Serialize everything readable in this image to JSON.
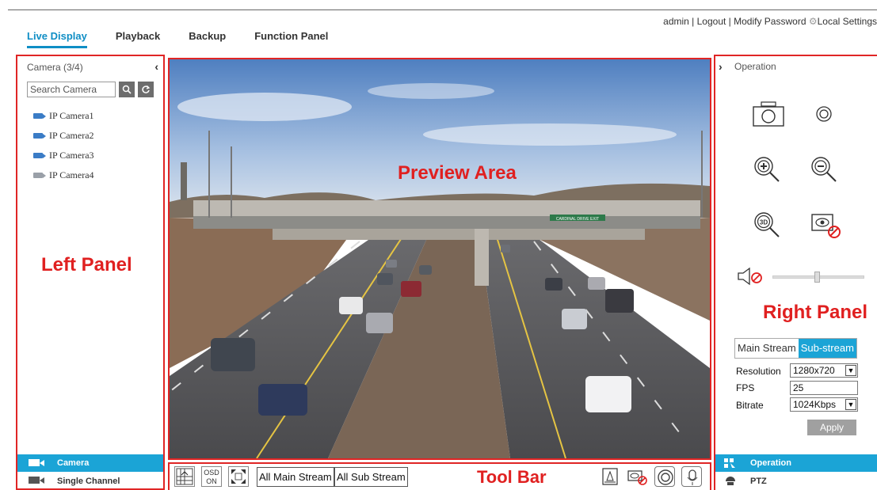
{
  "header": {
    "user": "admin |",
    "logout": "Logout |",
    "modify_password": "Modify Password",
    "local_settings": "Local Settings"
  },
  "nav": {
    "tabs": [
      {
        "label": "Live Display",
        "active": true
      },
      {
        "label": "Playback"
      },
      {
        "label": "Backup"
      },
      {
        "label": "Function Panel"
      }
    ]
  },
  "left_panel": {
    "header": "Camera (3/4)",
    "search_placeholder": "Search Camera",
    "cameras": [
      {
        "label": "IP Camera1",
        "online": true
      },
      {
        "label": "IP Camera2",
        "online": true
      },
      {
        "label": "IP Camera3",
        "online": true
      },
      {
        "label": "IP Camera4",
        "online": false
      }
    ],
    "annotation": "Left Panel",
    "bottom_tabs": [
      "Camera",
      "Single Channel Sequences"
    ]
  },
  "preview": {
    "annotation": "Preview Area",
    "sign_text": "CARDINAL DRIVE EXIT"
  },
  "toolbar": {
    "osd_line1": "OSD",
    "osd_line2": "ON",
    "all_main_stream": "All Main Stream",
    "all_sub_stream": "All Sub Stream",
    "annotation": "Tool Bar"
  },
  "right_panel": {
    "header": "Operation",
    "annotation": "Right Panel",
    "stream_tabs": [
      "Main Stream",
      "Sub-stream"
    ],
    "fields": {
      "resolution_label": "Resolution",
      "resolution_value": "1280x720",
      "fps_label": "FPS",
      "fps_value": "25",
      "bitrate_label": "Bitrate",
      "bitrate_value": "1024Kbps"
    },
    "apply": "Apply",
    "bottom_tabs": [
      "Operation",
      "PTZ"
    ]
  },
  "colors": {
    "accent": "#1ba4d6",
    "annotation_red": "#e02020"
  }
}
